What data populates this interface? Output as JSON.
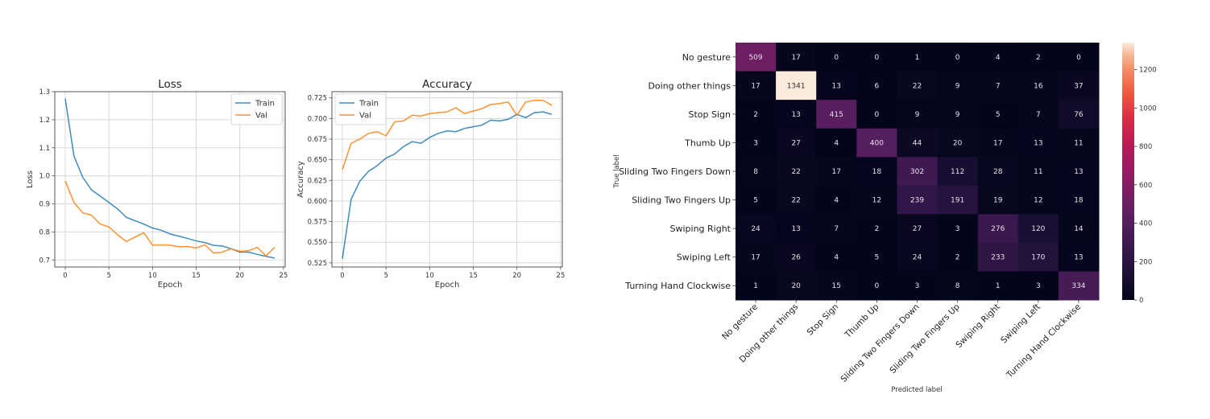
{
  "chart_data": [
    {
      "type": "line",
      "title": "Loss",
      "xlabel": "Epoch",
      "ylabel": "Loss",
      "xlim": [
        -1.2,
        25.2
      ],
      "ylim": [
        0.675,
        1.3
      ],
      "xticks": [
        0,
        5,
        10,
        15,
        20,
        25
      ],
      "yticks": [
        0.7,
        0.8,
        0.9,
        1.0,
        1.1,
        1.2,
        1.3
      ],
      "ytick_labels": [
        "0.7",
        "0.8",
        "0.9",
        "1.0",
        "1.1",
        "1.2",
        "1.3"
      ],
      "grid": true,
      "legend": "top-right",
      "x": [
        0,
        1,
        2,
        3,
        4,
        5,
        6,
        7,
        8,
        9,
        10,
        11,
        12,
        13,
        14,
        15,
        16,
        17,
        18,
        19,
        20,
        21,
        22,
        23,
        24
      ],
      "series": [
        {
          "name": "Train",
          "color": "#1f77b4",
          "values": [
            1.275,
            1.07,
            0.995,
            0.95,
            0.928,
            0.905,
            0.882,
            0.852,
            0.84,
            0.828,
            0.814,
            0.806,
            0.793,
            0.785,
            0.777,
            0.768,
            0.762,
            0.752,
            0.75,
            0.74,
            0.728,
            0.728,
            0.72,
            0.713,
            0.707
          ]
        },
        {
          "name": "Val",
          "color": "#ff7f0e",
          "values": [
            0.982,
            0.905,
            0.868,
            0.86,
            0.828,
            0.818,
            0.79,
            0.766,
            0.782,
            0.797,
            0.753,
            0.754,
            0.753,
            0.747,
            0.748,
            0.743,
            0.754,
            0.725,
            0.728,
            0.74,
            0.731,
            0.733,
            0.745,
            0.715,
            0.745
          ]
        }
      ]
    },
    {
      "type": "line",
      "title": "Accuracy",
      "xlabel": "Epoch",
      "ylabel": "Accuracy",
      "xlim": [
        -1.2,
        25.2
      ],
      "ylim": [
        0.52,
        0.7325
      ],
      "xticks": [
        0,
        5,
        10,
        15,
        20,
        25
      ],
      "yticks": [
        0.525,
        0.55,
        0.575,
        0.6,
        0.625,
        0.65,
        0.675,
        0.7,
        0.725
      ],
      "ytick_labels": [
        "0.525",
        "0.550",
        "0.575",
        "0.600",
        "0.625",
        "0.650",
        "0.675",
        "0.700",
        "0.725"
      ],
      "grid": true,
      "legend": "top-left",
      "x": [
        0,
        1,
        2,
        3,
        4,
        5,
        6,
        7,
        8,
        9,
        10,
        11,
        12,
        13,
        14,
        15,
        16,
        17,
        18,
        19,
        20,
        21,
        22,
        23,
        24
      ],
      "series": [
        {
          "name": "Train",
          "color": "#1f77b4",
          "values": [
            0.53,
            0.602,
            0.624,
            0.636,
            0.643,
            0.652,
            0.657,
            0.666,
            0.672,
            0.67,
            0.677,
            0.682,
            0.685,
            0.684,
            0.688,
            0.69,
            0.692,
            0.698,
            0.697,
            0.699,
            0.705,
            0.701,
            0.707,
            0.708,
            0.705
          ]
        },
        {
          "name": "Val",
          "color": "#ff7f0e",
          "values": [
            0.638,
            0.67,
            0.675,
            0.682,
            0.684,
            0.679,
            0.696,
            0.697,
            0.704,
            0.703,
            0.706,
            0.707,
            0.708,
            0.713,
            0.706,
            0.709,
            0.712,
            0.717,
            0.718,
            0.72,
            0.704,
            0.72,
            0.722,
            0.722,
            0.716
          ]
        }
      ]
    },
    {
      "type": "heatmap",
      "title": "",
      "xlabel": "Predicted label",
      "ylabel": "True label",
      "row_labels": [
        "No gesture",
        "Doing other things",
        "Stop Sign",
        "Thumb Up",
        "Sliding Two Fingers Down",
        "Sliding Two Fingers Up",
        "Swiping Right",
        "Swiping Left",
        "Turning Hand Clockwise"
      ],
      "col_labels": [
        "No gesture",
        "Doing other things",
        "Stop Sign",
        "Thumb Up",
        "Sliding Two Fingers Down",
        "Sliding Two Fingers Up",
        "Swiping Right",
        "Swiping Left",
        "Turning Hand Clockwise"
      ],
      "values": [
        [
          509,
          17,
          0,
          0,
          1,
          0,
          4,
          2,
          0
        ],
        [
          17,
          1341,
          13,
          6,
          22,
          9,
          7,
          16,
          37
        ],
        [
          2,
          13,
          415,
          0,
          9,
          9,
          5,
          7,
          76
        ],
        [
          3,
          27,
          4,
          400,
          44,
          20,
          17,
          13,
          11
        ],
        [
          8,
          22,
          17,
          18,
          302,
          112,
          28,
          11,
          13
        ],
        [
          5,
          22,
          4,
          12,
          239,
          191,
          19,
          12,
          18
        ],
        [
          24,
          13,
          7,
          2,
          27,
          3,
          276,
          120,
          14
        ],
        [
          17,
          26,
          4,
          5,
          24,
          2,
          233,
          170,
          13
        ],
        [
          1,
          20,
          15,
          0,
          3,
          8,
          1,
          3,
          334
        ]
      ],
      "colorbar": {
        "colormap": "rocket",
        "range": [
          0,
          1341
        ],
        "ticks": [
          0,
          200,
          400,
          600,
          800,
          1000,
          1200
        ],
        "tick_labels": [
          "0",
          "200",
          "400",
          "600",
          "800",
          "1000",
          "1200"
        ]
      }
    }
  ]
}
